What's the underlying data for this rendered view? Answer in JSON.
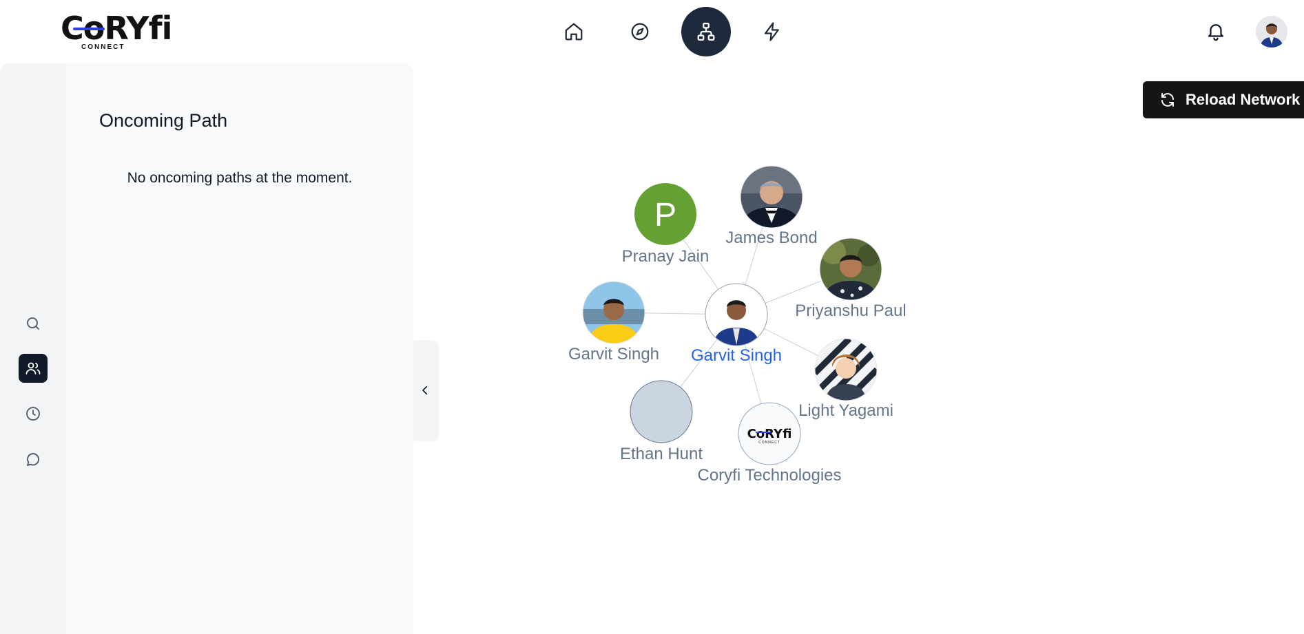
{
  "header": {
    "logo_text": "CoRYfi",
    "logo_sub": "CONNECT",
    "nav": [
      {
        "name": "nav-home",
        "icon": "home-icon",
        "active": false
      },
      {
        "name": "nav-explore",
        "icon": "compass-icon",
        "active": false
      },
      {
        "name": "nav-network",
        "icon": "network-icon",
        "active": true
      },
      {
        "name": "nav-activity",
        "icon": "lightning-icon",
        "active": false
      }
    ],
    "notification_icon": "bell-icon",
    "avatar_icon": "user-avatar"
  },
  "sidebar": {
    "items": [
      {
        "name": "search",
        "icon": "search-icon",
        "active": false
      },
      {
        "name": "connections",
        "icon": "users-icon",
        "active": true
      },
      {
        "name": "history",
        "icon": "clock-icon",
        "active": false
      },
      {
        "name": "messages",
        "icon": "chat-icon",
        "active": false
      }
    ]
  },
  "panel": {
    "title": "Oncoming Path",
    "empty_message": "No oncoming paths at the moment.",
    "collapse_icon": "chevron-left-icon"
  },
  "toolbar": {
    "reload_label": "Reload Network",
    "reload_icon": "refresh-icon"
  },
  "graph": {
    "center": {
      "label": "Garvit Singh"
    },
    "nodes": [
      {
        "label": "Pranay Jain",
        "initial": "P",
        "color": "#65a033"
      },
      {
        "label": "James Bond"
      },
      {
        "label": "Priyanshu Paul"
      },
      {
        "label": "Garvit Singh"
      },
      {
        "label": "Light Yagami"
      },
      {
        "label": "Ethan Hunt",
        "color": "#cbd5e1"
      },
      {
        "label": "Coryfi Technologies",
        "logo_text": "CoRYfi",
        "logo_sub": "CONNECT"
      }
    ]
  },
  "colors": {
    "nav_active": "#1e293b",
    "reload_bg": "#151515",
    "center_label": "#2563eb",
    "node_label": "#64748b"
  }
}
